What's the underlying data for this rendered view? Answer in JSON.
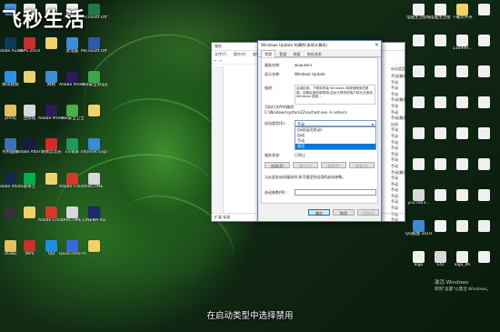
{
  "watermark": "飞秒生活",
  "subtitle": "在启动类型中选择禁用",
  "activation": {
    "line1": "激活 Windows",
    "line2": "转到\"设置\"以激活 Windows。"
  },
  "desktop_icons_left": [
    {
      "label": "",
      "color": "#4a8fd8"
    },
    {
      "label": "",
      "color": "#f0f0f0"
    },
    {
      "label": "",
      "color": "#f0f0f0"
    },
    {
      "label": "",
      "color": "#f0f0f0"
    },
    {
      "label": "Microsoft Office Exc...",
      "color": "#1f7a43"
    },
    {
      "label": "Adobe Audition...",
      "color": "#0a3a5a"
    },
    {
      "label": "WPS 2019",
      "color": "#c8302b"
    },
    {
      "label": "",
      "color": "#f0d26a"
    },
    {
      "label": "此电脑",
      "color": "#3b8fd6"
    },
    {
      "label": "Microsoft Office Wor...",
      "color": "#2b5bad"
    },
    {
      "label": "腾讯视频",
      "color": "#2f8fe0"
    },
    {
      "label": "",
      "color": "#f0d26a"
    },
    {
      "label": "网络",
      "color": "#3b8fd6"
    },
    {
      "label": "Adobe Premie...",
      "color": "#2a1a5a"
    },
    {
      "label": "360安全浏览器",
      "color": "#3aa64a"
    },
    {
      "label": "pmldj",
      "color": "#e0c060"
    },
    {
      "label": "回收站",
      "color": "#d8d8d8"
    },
    {
      "label": "Adobe Premie...",
      "color": "#2a1a5a"
    },
    {
      "label": "360安全卫士",
      "color": "#4cae4c"
    },
    {
      "label": "",
      "color": "#f0d26a"
    },
    {
      "label": "控制面板",
      "color": "#3b6fb8"
    },
    {
      "label": "Adobe After Effects CC",
      "color": "#1a1a4a"
    },
    {
      "label": "网易云音乐",
      "color": "#d02c2c"
    },
    {
      "label": "EV录屏",
      "color": "#1f9a5a"
    },
    {
      "label": "Internet Explorer",
      "color": "#3a8ad6"
    },
    {
      "label": "Adobe Photosh...",
      "color": "#0f2a4a"
    },
    {
      "label": "爱奇艺",
      "color": "#00b050"
    },
    {
      "label": "",
      "color": "#f0d26a"
    },
    {
      "label": "Adobe Creati...",
      "color": "#d43a2a"
    },
    {
      "label": "ARCTIME",
      "color": "#d8d8d8"
    },
    {
      "label": "",
      "color": "#333333"
    },
    {
      "label": "",
      "color": "#f0d26a"
    },
    {
      "label": "Adobe Creati...",
      "color": "#d43a2a"
    },
    {
      "label": "ARCTIME",
      "color": "#d8d8d8"
    },
    {
      "label": "CINEMA 4D",
      "color": "#1a2a6a"
    },
    {
      "label": "OGBD",
      "color": "#e0c060"
    },
    {
      "label": "WPS",
      "color": "#c8302b"
    },
    {
      "label": "QQ",
      "color": "#1f8fe0"
    },
    {
      "label": "QuickTime Player",
      "color": "#3a6ad6"
    },
    {
      "label": "",
      "color": "#f0d26a"
    }
  ],
  "desktop_icons_right": [
    {
      "label": "电脑生活壁纸",
      "color": "#f0f0f0"
    },
    {
      "label": "电脑生活壁",
      "color": "#f0f0f0"
    },
    {
      "label": "下载文件夹",
      "color": "#f0d26a"
    },
    {
      "label": "",
      "color": "#f0f0f0"
    },
    {
      "label": "",
      "color": "#f0f0f0"
    },
    {
      "label": "",
      "color": "#f0f0f0"
    },
    {
      "label": "134999...",
      "color": "#f0f0f0"
    },
    {
      "label": "",
      "color": "#f0f0f0"
    },
    {
      "label": "",
      "color": "#f0f0f0"
    },
    {
      "label": "",
      "color": "#f0f0f0"
    },
    {
      "label": "",
      "color": "#f0f0f0"
    },
    {
      "label": "",
      "color": "#f0f0f0"
    },
    {
      "label": "",
      "color": "#f0f0f0"
    },
    {
      "label": "",
      "color": "#f0f0f0"
    },
    {
      "label": "",
      "color": "#f0f0f0"
    },
    {
      "label": "",
      "color": "#f0f0f0"
    },
    {
      "label": "",
      "color": "#f0f0f0"
    },
    {
      "label": "",
      "color": "#f0f0f0"
    },
    {
      "label": "",
      "color": "#f0f0f0"
    },
    {
      "label": "",
      "color": "#f0f0f0"
    },
    {
      "label": "",
      "color": "#f0f0f0"
    },
    {
      "label": "",
      "color": "#f0f0f0"
    },
    {
      "label": "",
      "color": "#f0f0f0"
    },
    {
      "label": "",
      "color": "#f0f0f0"
    },
    {
      "label": "yn27063...",
      "color": "#d8d8d8"
    },
    {
      "label": "",
      "color": "#f0f0f0"
    },
    {
      "label": "",
      "color": "#f0f0f0"
    },
    {
      "label": "",
      "color": "#f0f0f0"
    },
    {
      "label": "QQ截图 2019052...",
      "color": "#3a8ad6"
    },
    {
      "label": "",
      "color": "#f0f0f0"
    },
    {
      "label": "",
      "color": "#f0f0f0"
    },
    {
      "label": "",
      "color": "#f0f0f0"
    },
    {
      "label": "logo",
      "color": "#f0f0f0"
    },
    {
      "label": "141",
      "color": "#d8d8d8"
    },
    {
      "label": "logo_dh",
      "color": "#f0f0f0"
    },
    {
      "label": "",
      "color": "#f0f0f0"
    }
  ],
  "explorer": {
    "title": "服务",
    "menu": [
      "文件(F)",
      "操作(A)",
      "查看(V)",
      "帮助(H)"
    ],
    "nav": "← →",
    "column_header": "启动类型",
    "rows": [
      "手动(触发...",
      "手动",
      "手动",
      "手动",
      "手动(触发...",
      "手动",
      "手动",
      "手动(触发...",
      "自动",
      "手动",
      "手动",
      "手动",
      "手动",
      "手动",
      "手动",
      "手动",
      "手动(触发...",
      "手动",
      "手动",
      "手动",
      "手动",
      "手动",
      "手动",
      "手动",
      "手动",
      "手动(触发..."
    ],
    "bottom_tabs": "扩展 标准"
  },
  "dialog": {
    "title": "Windows Update 的属性(本地计算机)",
    "close": "×",
    "tabs": [
      "常规",
      "登录",
      "恢复",
      "依存关系"
    ],
    "service_name_label": "服务名称:",
    "service_name": "wuauserv",
    "display_name_label": "显示名称:",
    "display_name": "Windows Update",
    "description_label": "描述:",
    "description": "启用检测、下载和安装 Windows 和其他程序的更新。如果此服务被禁用,这台计算机的用户将无法使用 Windows 更新...",
    "exe_path_label": "可执行文件的路径:",
    "exe_path": "C:\\Windows\\system32\\svchost.exe -k netsvcs",
    "startup_type_label": "启动类型(E):",
    "startup_type_value": "手动",
    "startup_options": [
      "自动(延迟启动)",
      "自动",
      "手动",
      "禁用"
    ],
    "selected_option_index": 3,
    "service_status_label": "服务状态:",
    "service_status": "已停止",
    "buttons": [
      "启动(S)",
      "停止(T)",
      "暂停(P)",
      "恢复(R)"
    ],
    "hint": "当从此处启动服务时,你可指定所适用的启动参数。",
    "start_params_label": "启动参数(M):",
    "ok": "确定",
    "cancel": "取消",
    "apply": "应用(A)"
  }
}
